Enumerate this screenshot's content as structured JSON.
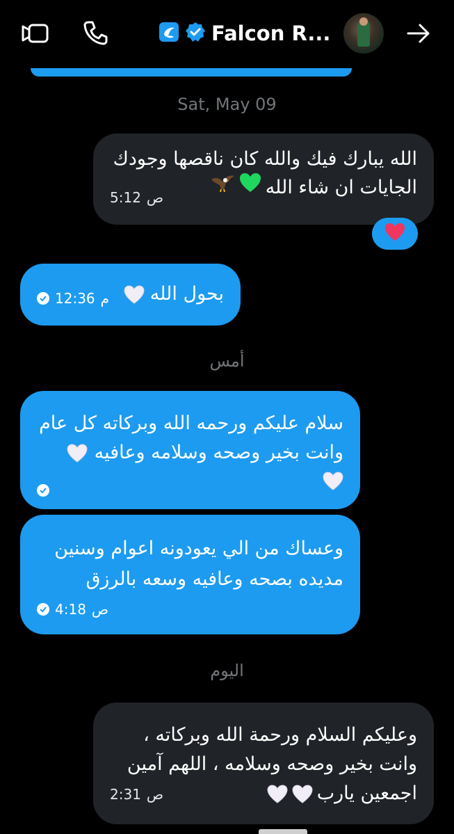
{
  "header": {
    "title": "Falcon R...",
    "verified": true,
    "icons": {
      "video": "video-camera-icon",
      "call": "phone-icon",
      "info": "arrow-right-icon",
      "brand": "brand-logo-icon",
      "verified": "verified-badge-icon"
    }
  },
  "colors": {
    "background": "#000000",
    "outgoing_bubble": "#1d9bf0",
    "incoming_bubble": "#202327",
    "muted_text": "#71767b"
  },
  "dates": {
    "d1": "Sat, May 09",
    "d2": "أمس",
    "d3": "اليوم"
  },
  "messages": [
    {
      "direction": "incoming",
      "line1": "الله يبارك فيك والله كان ناقصها وجودك",
      "line2": "الجايات ان شاء الله",
      "time": "5:12",
      "period": "ص",
      "emojis": [
        "green-heart",
        "eagle"
      ]
    },
    {
      "direction": "outgoing",
      "line1": "بحول الله",
      "time": "12:36",
      "period": "م",
      "emojis": [
        "white-heart"
      ],
      "read": true
    },
    {
      "direction": "outgoing",
      "line1": "سلام عليكم ورحمه الله وبركاته  كل عام",
      "line2": "وانت بخير وصحه وسلامه وعافيه",
      "emojis": [
        "white-heart",
        "white-heart"
      ],
      "read": true
    },
    {
      "direction": "outgoing",
      "line1": "وعساك من الي يعودونه اعوام وسنين",
      "line2": "مديده  بصحه وعافيه وسعه بالرزق",
      "time": "4:18",
      "period": "ص",
      "read": true
    },
    {
      "direction": "incoming",
      "line1": "وعليكم السلام ورحمة الله وبركاته ،",
      "line2": "وانت بخير وصحه وسلامه ، اللهم آمين",
      "line3": "اجمعين يارب",
      "time": "2:31",
      "period": "ص",
      "emojis": [
        "white-heart",
        "white-heart"
      ]
    }
  ],
  "reaction": "red-heart"
}
